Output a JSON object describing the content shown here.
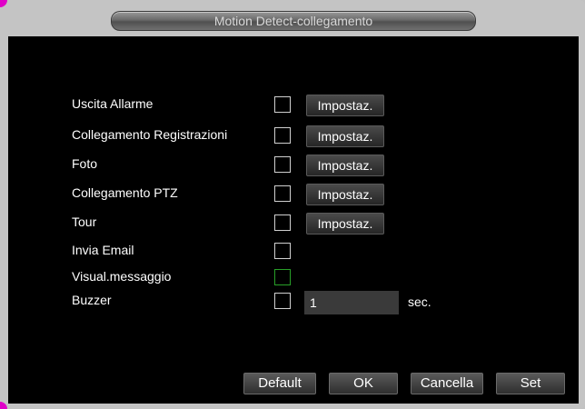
{
  "window": {
    "title": "Motion Detect-collegamento"
  },
  "rows": [
    {
      "label": "Uscita Allarme",
      "checked": false,
      "setup_label": "Impostaz."
    },
    {
      "label": "Collegamento Registrazioni",
      "checked": false,
      "setup_label": "Impostaz."
    },
    {
      "label": "Foto",
      "checked": false,
      "setup_label": "Impostaz."
    },
    {
      "label": "Collegamento PTZ",
      "checked": false,
      "setup_label": "Impostaz."
    },
    {
      "label": "Tour",
      "checked": false,
      "setup_label": "Impostaz."
    },
    {
      "label": "Invia Email",
      "checked": false
    },
    {
      "label": "Visual.messaggio",
      "checked": false,
      "focused": true
    },
    {
      "label": "Buzzer",
      "checked": false,
      "duration_value": "1",
      "duration_unit": "sec."
    }
  ],
  "buttons": {
    "default": "Default",
    "ok": "OK",
    "cancel": "Cancella",
    "set": "Set"
  },
  "colors": {
    "panel_bg": "#000000",
    "frame_bg": "#c4c4c4",
    "focus_border": "#28a028",
    "corner_accent": "#e000c8"
  }
}
